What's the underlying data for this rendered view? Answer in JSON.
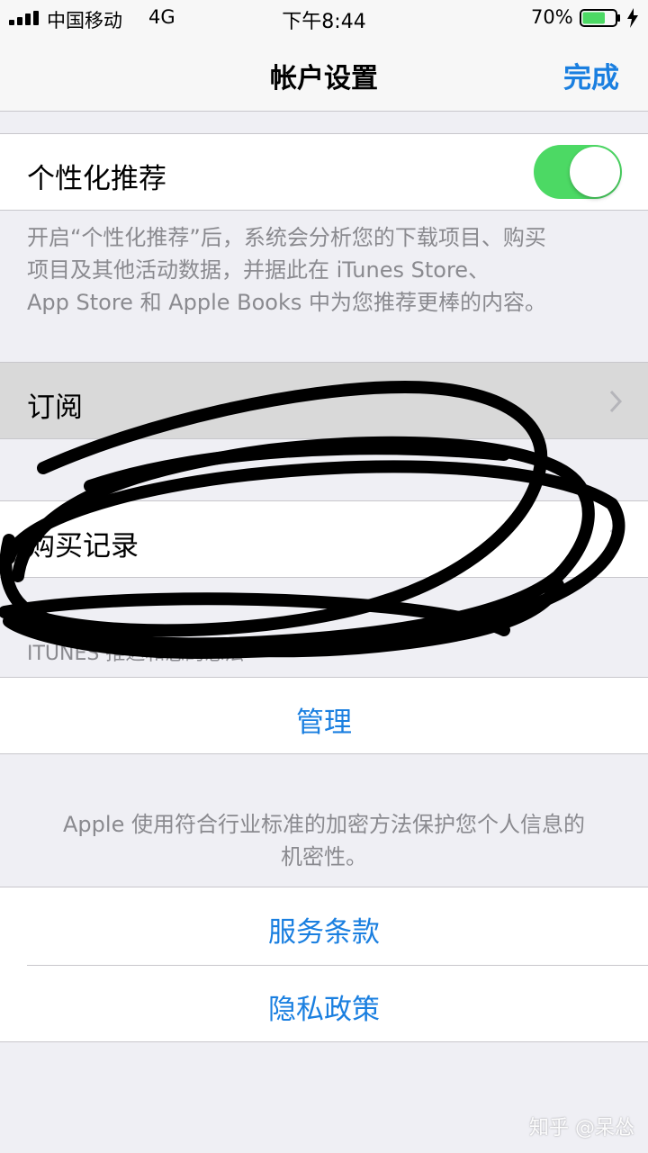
{
  "status_bar": {
    "carrier": "中国移动",
    "network": "4G",
    "time": "下午8:44",
    "battery_percent": "70%",
    "battery_level": 0.7
  },
  "nav": {
    "title": "帐户设置",
    "done_label": "完成"
  },
  "personalized": {
    "label": "个性化推荐",
    "enabled": true,
    "footnote_lines": [
      "开启“个性化推荐”后，系统会分析您的下载项目、购买",
      "项目及其他活动数据，并据此在 iTunes Store、",
      "App Store 和 Apple Books 中为您推荐更棒的内容。"
    ]
  },
  "subscriptions": {
    "label": "订阅"
  },
  "purchase_history": {
    "label": "购买记录"
  },
  "itunes_section": {
    "header": "ITUNES 推迟和您的想法",
    "manage_label": "管理"
  },
  "privacy_note": {
    "lines": [
      "Apple 使用符合行业标准的加密方法保护您个人信息的",
      "机密性。"
    ]
  },
  "links": {
    "terms": "服务条款",
    "privacy": "隐私政策"
  },
  "watermark": "知乎 @呆怂",
  "colors": {
    "accent": "#1a7fe0",
    "toggle_on": "#4cd964",
    "background": "#efeff4"
  }
}
